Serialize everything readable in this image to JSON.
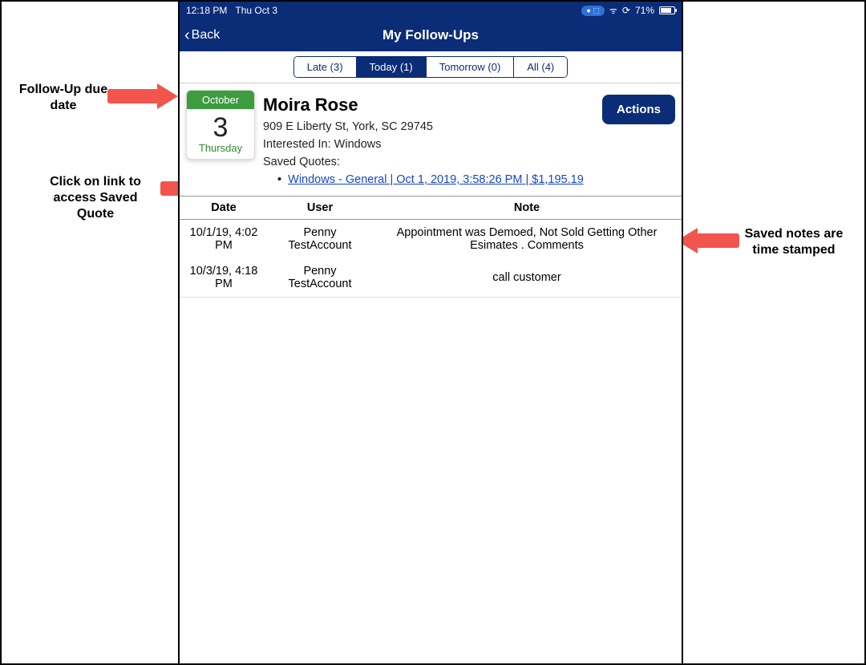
{
  "status": {
    "time": "12:18 PM",
    "date": "Thu Oct 3",
    "battery_text": "71%",
    "cast_icon": "⎚",
    "wifi_icon": "᯾"
  },
  "nav": {
    "back_label": "Back",
    "title": "My Follow-Ups"
  },
  "tabs": {
    "late": "Late (3)",
    "today": "Today (1)",
    "tomorrow": "Tomorrow (0)",
    "all": "All (4)"
  },
  "date_tile": {
    "month": "October",
    "day_num": "3",
    "day_name": "Thursday"
  },
  "lead": {
    "name": "Moira Rose",
    "address": "909 E Liberty St, York, SC 29745",
    "interested_label": "Interested In: Windows",
    "saved_quotes_label": "Saved Quotes:",
    "quote_link_text": "Windows - General | Oct 1, 2019, 3:58:26 PM | $1,195.19"
  },
  "actions_label": "Actions",
  "notes_header": {
    "date": "Date",
    "user": "User",
    "note": "Note"
  },
  "notes": [
    {
      "date": "10/1/19, 4:02 PM",
      "user": "Penny TestAccount",
      "note": "Appointment was Demoed, Not Sold Getting Other Esimates . Comments"
    },
    {
      "date": "10/3/19, 4:18 PM",
      "user": "Penny TestAccount",
      "note": "call customer"
    }
  ],
  "annotations": {
    "due_date": "Follow-Up due date",
    "quote_link": "Click on link to access Saved Quote",
    "notes_stamp": "Saved notes are time stamped"
  }
}
